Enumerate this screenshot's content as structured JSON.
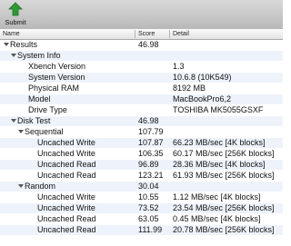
{
  "toolbar": {
    "submit_label": "Submit",
    "submit_icon": "green-upload-arrow-icon"
  },
  "columns": {
    "name": "Name",
    "score": "Score",
    "detail": "Detail"
  },
  "rows": [
    {
      "name": "Results",
      "score": "46.98",
      "detail": "",
      "expandable": true
    },
    {
      "name": "System Info",
      "score": "",
      "detail": "",
      "expandable": true
    },
    {
      "name": "Xbench Version",
      "score": "",
      "detail": "1.3",
      "expandable": false
    },
    {
      "name": "System Version",
      "score": "",
      "detail": "10.6.8 (10K549)",
      "expandable": false
    },
    {
      "name": "Physical RAM",
      "score": "",
      "detail": "8192 MB",
      "expandable": false
    },
    {
      "name": "Model",
      "score": "",
      "detail": "MacBookPro6,2",
      "expandable": false
    },
    {
      "name": "Drive Type",
      "score": "",
      "detail": "TOSHIBA MK5055GSXF",
      "expandable": false
    },
    {
      "name": "Disk Test",
      "score": "46.98",
      "detail": "",
      "expandable": true
    },
    {
      "name": "Sequential",
      "score": "107.79",
      "detail": "",
      "expandable": true
    },
    {
      "name": "Uncached Write",
      "score": "107.87",
      "detail": "66.23 MB/sec [4K blocks]",
      "expandable": false
    },
    {
      "name": "Uncached Write",
      "score": "106.35",
      "detail": "60.17 MB/sec [256K blocks]",
      "expandable": false
    },
    {
      "name": "Uncached Read",
      "score": "96.89",
      "detail": "28.36 MB/sec [4K blocks]",
      "expandable": false
    },
    {
      "name": "Uncached Read",
      "score": "123.21",
      "detail": "61.93 MB/sec [256K blocks]",
      "expandable": false
    },
    {
      "name": "Random",
      "score": "30.04",
      "detail": "",
      "expandable": true
    },
    {
      "name": "Uncached Write",
      "score": "10.55",
      "detail": "1.12 MB/sec [4K blocks]",
      "expandable": false
    },
    {
      "name": "Uncached Write",
      "score": "73.52",
      "detail": "23.54 MB/sec [256K blocks]",
      "expandable": false
    },
    {
      "name": "Uncached Read",
      "score": "63.05",
      "detail": "0.45 MB/sec [4K blocks]",
      "expandable": false
    },
    {
      "name": "Uncached Read",
      "score": "111.99",
      "detail": "20.78 MB/sec [256K blocks]",
      "expandable": false
    }
  ],
  "colors": {
    "alt_row": "#eef3fb",
    "icon_green": "#2f9a35"
  }
}
